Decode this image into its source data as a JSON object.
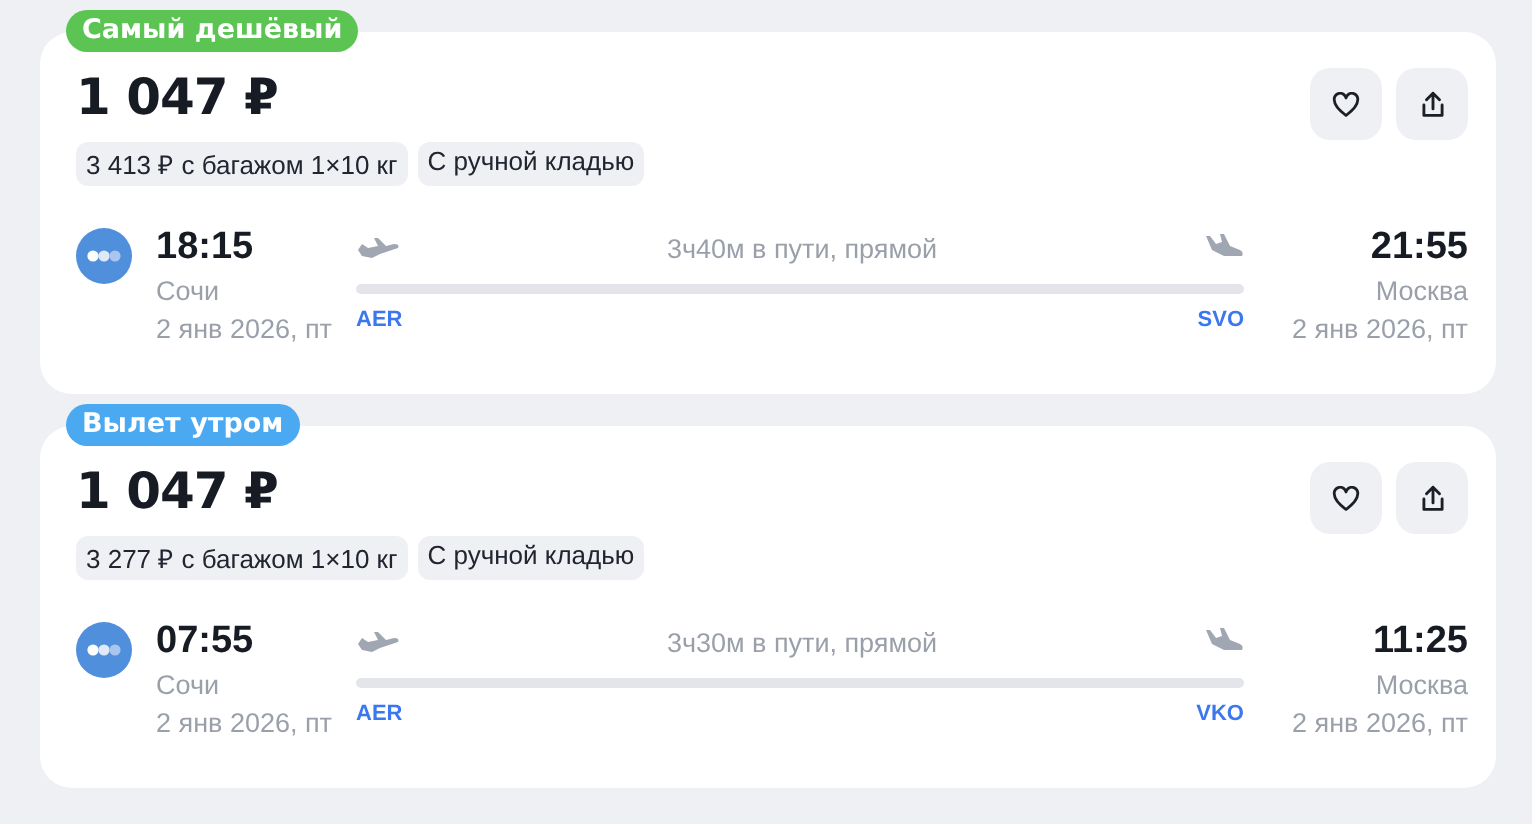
{
  "offers": [
    {
      "badge": {
        "label": "Самый дешёвый",
        "color": "#5bc453"
      },
      "price": "1 047 ₽",
      "chips": [
        "3 413 ₽ с багажом 1×10 кг",
        "С ручной кладью"
      ],
      "departure": {
        "time": "18:15",
        "city": "Сочи",
        "date": "2 янв 2026, пт",
        "code": "AER"
      },
      "arrival": {
        "time": "21:55",
        "city": "Москва",
        "date": "2 янв 2026, пт",
        "code": "SVO"
      },
      "duration": "3ч40м в пути, прямой"
    },
    {
      "badge": {
        "label": "Вылет утром",
        "color": "#4ba9f2"
      },
      "price": "1 047 ₽",
      "chips": [
        "3 277 ₽ с багажом 1×10 кг",
        "С ручной кладью"
      ],
      "departure": {
        "time": "07:55",
        "city": "Сочи",
        "date": "2 янв 2026, пт",
        "code": "AER"
      },
      "arrival": {
        "time": "11:25",
        "city": "Москва",
        "date": "2 янв 2026, пт",
        "code": "VKO"
      },
      "duration": "3ч30м в пути, прямой"
    }
  ]
}
